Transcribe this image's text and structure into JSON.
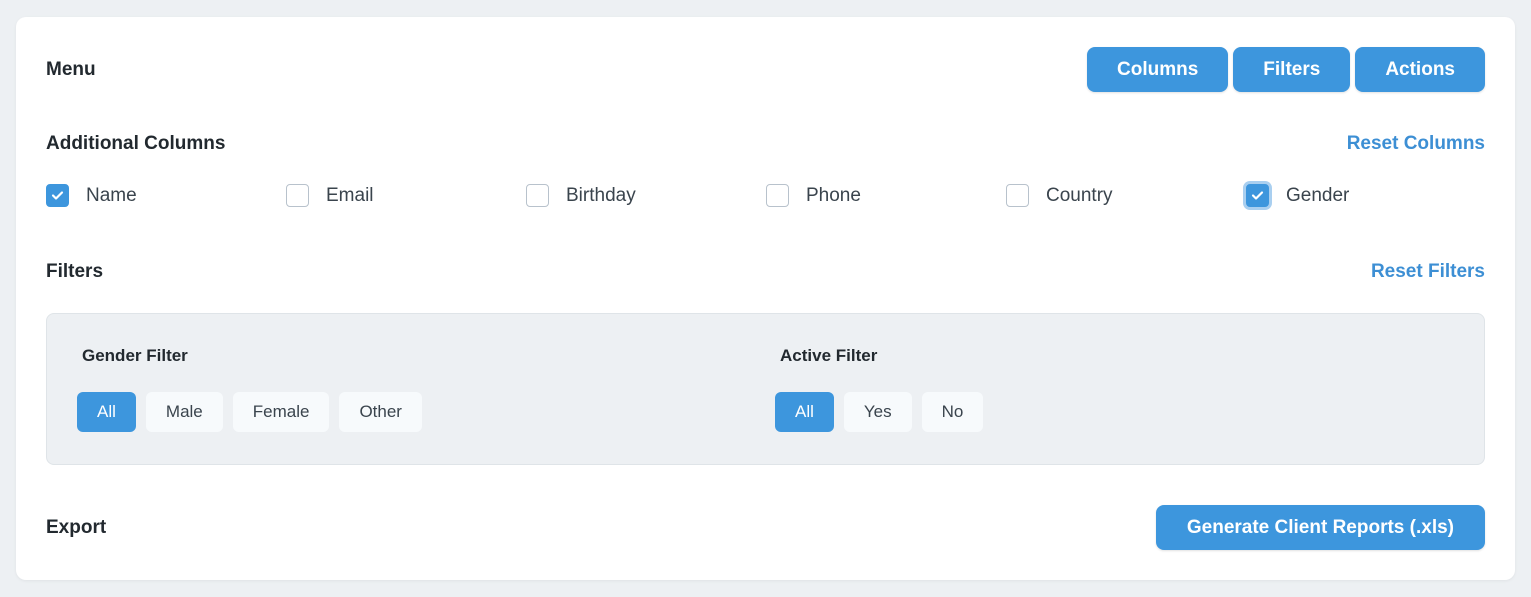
{
  "menu": {
    "title": "Menu",
    "buttons": [
      "Columns",
      "Filters",
      "Actions"
    ]
  },
  "columns": {
    "title": "Additional Columns",
    "reset_label": "Reset Columns",
    "items": [
      {
        "label": "Name",
        "checked": true
      },
      {
        "label": "Email",
        "checked": false
      },
      {
        "label": "Birthday",
        "checked": false
      },
      {
        "label": "Phone",
        "checked": false
      },
      {
        "label": "Country",
        "checked": false
      },
      {
        "label": "Gender",
        "checked": true
      }
    ]
  },
  "filters": {
    "title": "Filters",
    "reset_label": "Reset Filters",
    "gender": {
      "title": "Gender Filter",
      "options": [
        "All",
        "Male",
        "Female",
        "Other"
      ],
      "selected": "All"
    },
    "active": {
      "title": "Active Filter",
      "options": [
        "All",
        "Yes",
        "No"
      ],
      "selected": "All"
    }
  },
  "export": {
    "title": "Export",
    "button_label": "Generate Client Reports (.xls)"
  },
  "colors": {
    "accent": "#3d96dd",
    "link": "#3d8fd4",
    "page_bg": "#edf0f3",
    "card_bg": "#ffffff"
  },
  "icons": {
    "checkbox_checked": "check-icon"
  }
}
